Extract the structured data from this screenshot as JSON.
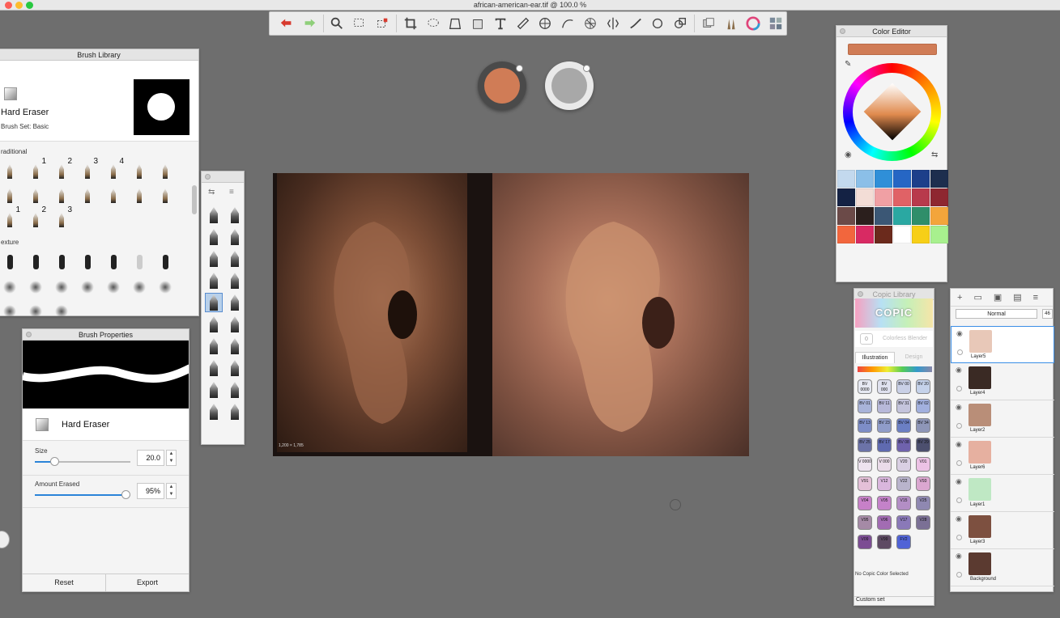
{
  "window": {
    "title": "african-american-ear.tif @ 100.0 %"
  },
  "toolbar": {
    "tools": [
      "undo-icon",
      "redo-icon",
      "zoom-icon",
      "marquee-select-icon",
      "transform-select-icon",
      "crop-icon",
      "lasso-icon",
      "perspective-icon",
      "fill-icon",
      "text-icon",
      "ruler-icon",
      "ellipse-guide-icon",
      "french-curve-icon",
      "perspective-grid-icon",
      "symmetry-icon",
      "stroke-icon",
      "predictive-stroke-icon",
      "shape-icon",
      "layers-copy-icon",
      "brush-library-icon",
      "color-wheel-icon",
      "copic-library-icon"
    ]
  },
  "pucks": {
    "foreground": "#d07c56",
    "background": "#a8a8a8"
  },
  "brush_library": {
    "title": "Brush Library",
    "current_brush": "Hard Eraser",
    "brush_set": "Brush Set: Basic",
    "section_traditional": "raditional",
    "section_texture": "exture",
    "traditional_nums": [
      "",
      "1",
      "2",
      "3",
      "4",
      "",
      "",
      "",
      "",
      "",
      "",
      "",
      "",
      "",
      "1",
      "2",
      "3"
    ]
  },
  "brush_properties": {
    "title": "Brush Properties",
    "brush_name": "Hard Eraser",
    "size_label": "Size",
    "size_value": "20.0",
    "size_fraction": 0.2,
    "amount_label": "Amount Erased",
    "amount_value": "95%",
    "amount_fraction": 0.95,
    "reset_label": "Reset",
    "export_label": "Export"
  },
  "canvas": {
    "size_tag": "1,200 × 1,785"
  },
  "color_editor": {
    "title": "Color Editor",
    "current_color": "#d07c56",
    "swatches": [
      "#c3d9ee",
      "#8bbfe8",
      "#2f8fd8",
      "#2666c4",
      "#1d3f8a",
      "#1d2e4e",
      "#142244",
      "#f3ddd6",
      "#f0a0a4",
      "#e06266",
      "#b83a4c",
      "#8e2730",
      "#6b4a48",
      "#2b1f1d",
      "#3b5775",
      "#2aa8a2",
      "#2f8e6a",
      "#f3a53b",
      "#f2663d",
      "#d82a63",
      "#6b2a1c",
      "#ffffff",
      "#f7cf17",
      "#a8f08e"
    ]
  },
  "copic": {
    "title": "Copic Library",
    "logo": "COPIC",
    "colorless_blender": "Colorless Blender",
    "colorless_code": "0",
    "tab_illustration": "Illustration",
    "tab_design": "Design",
    "no_selection": "No Copic Color Selected",
    "custom_set": "Custom set",
    "chips": [
      {
        "code": "BV 0000",
        "color": "#e6e9f2"
      },
      {
        "code": "BV 000",
        "color": "#dfe1ee"
      },
      {
        "code": "BV 00",
        "color": "#c9d0e6"
      },
      {
        "code": "BV 20",
        "color": "#c5d2ea"
      },
      {
        "code": "BV 01",
        "color": "#a8b3d9"
      },
      {
        "code": "BV 11",
        "color": "#b7b8d9"
      },
      {
        "code": "BV 31",
        "color": "#c4c4dc"
      },
      {
        "code": "BV 02",
        "color": "#a2b0de"
      },
      {
        "code": "BV 13",
        "color": "#7d8dc7"
      },
      {
        "code": "BV 23",
        "color": "#8f9cc9"
      },
      {
        "code": "BV 04",
        "color": "#6b7fc4"
      },
      {
        "code": "BV 34",
        "color": "#8e96b8"
      },
      {
        "code": "BV 25",
        "color": "#6c73a8"
      },
      {
        "code": "BV 17",
        "color": "#5f6ab0"
      },
      {
        "code": "BV 08",
        "color": "#6f62ad"
      },
      {
        "code": "BV 29",
        "color": "#4c4f6e"
      },
      {
        "code": "V 0000",
        "color": "#ede3ef"
      },
      {
        "code": "V 000",
        "color": "#eadbe9"
      },
      {
        "code": "V20",
        "color": "#d9cfe3"
      },
      {
        "code": "V01",
        "color": "#ecc2e5"
      },
      {
        "code": "V91",
        "color": "#e4c0d8"
      },
      {
        "code": "V12",
        "color": "#d9b6dd"
      },
      {
        "code": "V22",
        "color": "#b9b4cc"
      },
      {
        "code": "V93",
        "color": "#dba7d0"
      },
      {
        "code": "V04",
        "color": "#c780c8"
      },
      {
        "code": "V05",
        "color": "#c482c9"
      },
      {
        "code": "V15",
        "color": "#b38ec5"
      },
      {
        "code": "V25",
        "color": "#8f88b1"
      },
      {
        "code": "V95",
        "color": "#a58aa6"
      },
      {
        "code": "V06",
        "color": "#a26cb3"
      },
      {
        "code": "V17",
        "color": "#8a79b8"
      },
      {
        "code": "V28",
        "color": "#7b7095"
      },
      {
        "code": "V09",
        "color": "#7c4c93"
      },
      {
        "code": "V99",
        "color": "#5e4a63"
      },
      {
        "code": "FV2",
        "color": "#5063d6"
      }
    ]
  },
  "layers": {
    "blend_mode": "Normal",
    "opacity_tag": "46",
    "items": [
      {
        "name": "Layer5",
        "thumb": "#e8c8b8"
      },
      {
        "name": "Layer4",
        "thumb": "#3a2a24"
      },
      {
        "name": "Layer2",
        "thumb": "#b98e78"
      },
      {
        "name": "Layer6",
        "thumb": "#e6b0a0"
      },
      {
        "name": "Layer1",
        "thumb": "#bfe8c4"
      },
      {
        "name": "Layer3",
        "thumb": "#7d5040"
      },
      {
        "name": "Background",
        "thumb": "#5b3a30"
      }
    ]
  }
}
